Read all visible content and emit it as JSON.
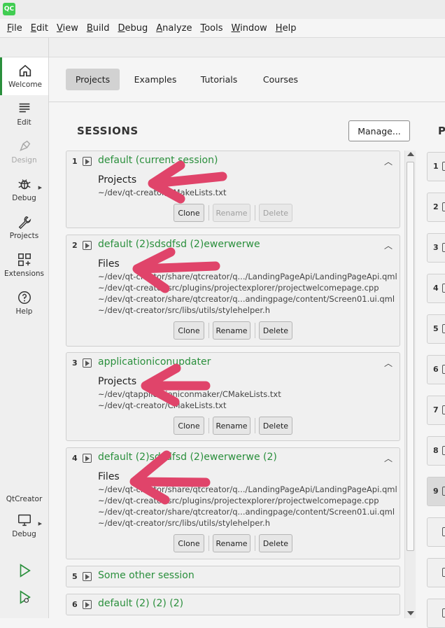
{
  "app": {
    "logo": "QC"
  },
  "menu": [
    {
      "mn": "F",
      "rest": "ile"
    },
    {
      "mn": "E",
      "rest": "dit"
    },
    {
      "mn": "V",
      "rest": "iew"
    },
    {
      "mn": "B",
      "rest": "uild"
    },
    {
      "mn": "D",
      "rest": "ebug"
    },
    {
      "mn": "A",
      "rest": "nalyze"
    },
    {
      "mn": "T",
      "rest": "ools"
    },
    {
      "mn": "W",
      "rest": "indow"
    },
    {
      "mn": "H",
      "rest": "elp"
    }
  ],
  "modes": [
    {
      "label": "Welcome",
      "icon": "home-icon"
    },
    {
      "label": "Edit",
      "icon": "edit-icon"
    },
    {
      "label": "Design",
      "icon": "design-icon"
    },
    {
      "label": "Debug",
      "icon": "bug-icon"
    },
    {
      "label": "Projects",
      "icon": "wrench-icon"
    },
    {
      "label": "Extensions",
      "icon": "extensions-icon"
    },
    {
      "label": "Help",
      "icon": "help-icon"
    }
  ],
  "kit": {
    "label": "QtCreator",
    "mode": "Debug"
  },
  "tabs": [
    "Projects",
    "Examples",
    "Tutorials",
    "Courses"
  ],
  "sessions_title": "SESSIONS",
  "manage_label": "Manage...",
  "projects_title": "P",
  "buttons": {
    "clone": "Clone",
    "rename": "Rename",
    "delete": "Delete"
  },
  "sessions": [
    {
      "num": "1",
      "name": "default (current session)",
      "head": "Projects",
      "files": [
        "~/dev/qt-creator/CMakeLists.txt"
      ]
    },
    {
      "num": "2",
      "name": "default (2)sdsdfsd (2)ewerwerwe",
      "head": "Files",
      "files": [
        "~/dev/qt-creator/share/qtcreator/q.../LandingPageApi/LandingPageApi.qml",
        "~/dev/qt-creator/src/plugins/projectexplorer/projectwelcomepage.cpp",
        "~/dev/qt-creator/share/qtcreator/q...andingpage/content/Screen01.ui.qml",
        "~/dev/qt-creator/src/libs/utils/stylehelper.h"
      ]
    },
    {
      "num": "3",
      "name": "applicationiconupdater",
      "head": "Projects",
      "files": [
        "~/dev/qtapplicationiconmaker/CMakeLists.txt",
        "~/dev/qt-creator/CMakeLists.txt"
      ]
    },
    {
      "num": "4",
      "name": "default (2)sdsdfsd (2)ewerwerwe (2)",
      "head": "Files",
      "files": [
        "~/dev/qt-creator/share/qtcreator/q.../LandingPageApi/LandingPageApi.qml",
        "~/dev/qt-creator/src/plugins/projectexplorer/projectwelcomepage.cpp",
        "~/dev/qt-creator/share/qtcreator/q...andingpage/content/Screen01.ui.qml",
        "~/dev/qt-creator/src/libs/utils/stylehelper.h"
      ]
    },
    {
      "num": "5",
      "name": "Some other session"
    },
    {
      "num": "6",
      "name": "default (2) (2) (2)"
    }
  ],
  "project_numbers": [
    "1",
    "2",
    "3",
    "4",
    "5",
    "6",
    "7",
    "8",
    "9",
    "",
    "",
    ""
  ],
  "colors": {
    "accent": "#2a8f3c",
    "annotation": "#e0446a"
  }
}
